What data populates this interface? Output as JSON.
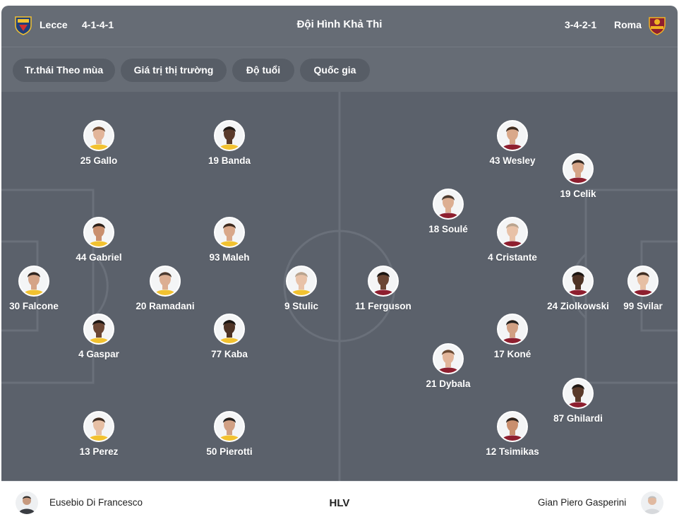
{
  "header": {
    "home_team": "Lecce",
    "home_formation": "4-1-4-1",
    "title": "Đội Hình Khả Thi",
    "away_formation": "3-4-2-1",
    "away_team": "Roma"
  },
  "filters": [
    "Tr.thái Theo mùa",
    "Giá trị thị trường",
    "Độ tuổi",
    "Quốc gia"
  ],
  "home_players": [
    {
      "label": "25 Gallo"
    },
    {
      "label": "19 Banda"
    },
    {
      "label": "44 Gabriel"
    },
    {
      "label": "93 Maleh"
    },
    {
      "label": "30 Falcone"
    },
    {
      "label": "20 Ramadani"
    },
    {
      "label": "9 Stulic"
    },
    {
      "label": "4 Gaspar"
    },
    {
      "label": "77 Kaba"
    },
    {
      "label": "13 Perez"
    },
    {
      "label": "50 Pierotti"
    }
  ],
  "away_players": [
    {
      "label": "43 Wesley"
    },
    {
      "label": "19 Celik"
    },
    {
      "label": "18 Soulé"
    },
    {
      "label": "4 Cristante"
    },
    {
      "label": "11 Ferguson"
    },
    {
      "label": "24 Ziolkowski"
    },
    {
      "label": "99 Svilar"
    },
    {
      "label": "17 Koné"
    },
    {
      "label": "21 Dybala"
    },
    {
      "label": "87 Ghilardi"
    },
    {
      "label": "12 Tsimikas"
    }
  ],
  "coaches": {
    "home": "Eusebio Di Francesco",
    "label": "HLV",
    "away": "Gian Piero Gasperini"
  },
  "colors": {
    "header_bg": "#666c75",
    "pitch_bg": "#5b616b",
    "chip_bg": "#575d66",
    "lecce_yellow": "#f2c230",
    "lecce_blue": "#1f3f7a",
    "roma_red": "#8e1f2f",
    "roma_gold": "#f0b323"
  },
  "icons": {
    "home_logo": "lecce-crest-icon",
    "away_logo": "roma-crest-icon",
    "player_photo": "player-avatar-icon",
    "coach_photo": "coach-avatar-icon"
  }
}
